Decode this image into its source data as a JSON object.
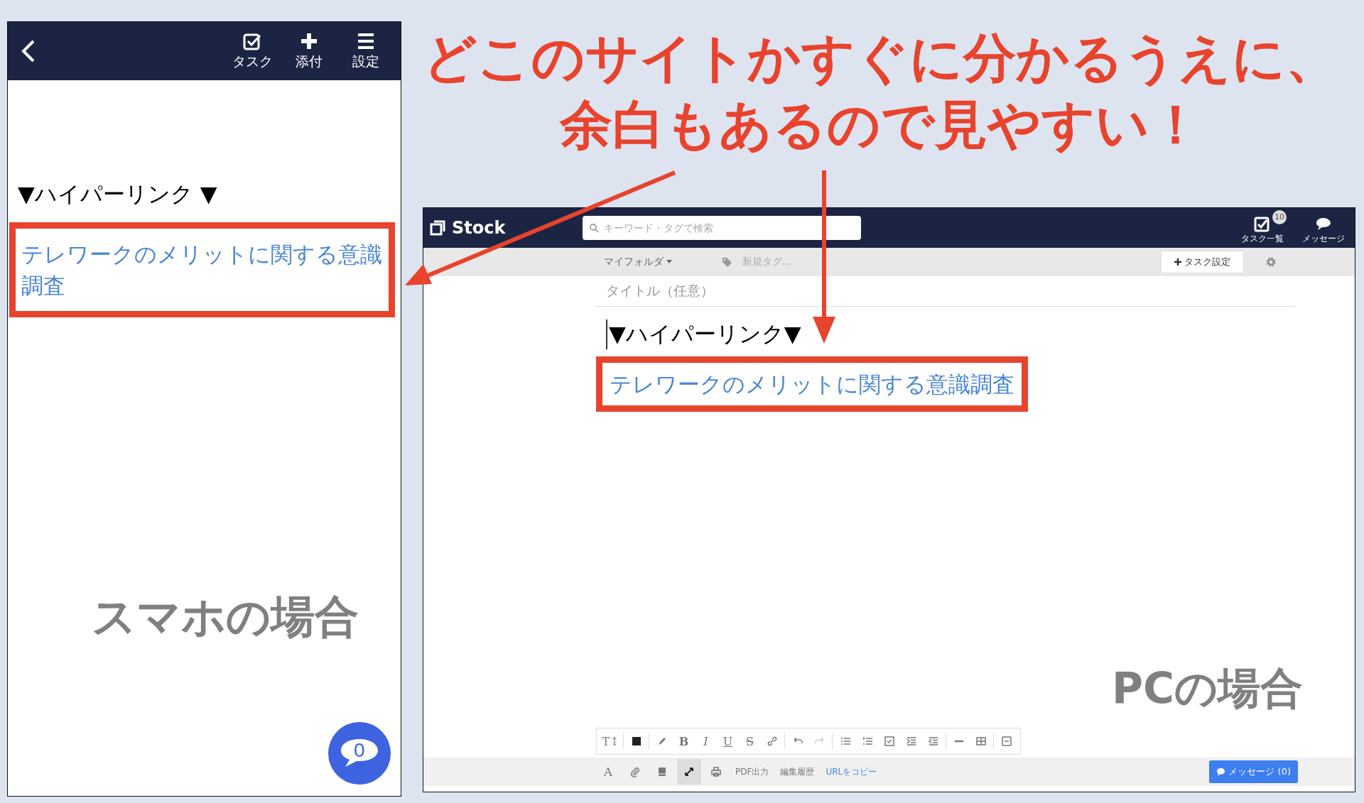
{
  "headline": [
    "どこのサイトかすぐに分かるうえに、",
    "余白もあるので見やすい！"
  ],
  "phone": {
    "toolbar": [
      {
        "kind": "task",
        "label": "タスク"
      },
      {
        "kind": "attach",
        "label": "添付"
      },
      {
        "kind": "settings",
        "label": "設定"
      }
    ],
    "heading": "▼ハイパーリンク ▼",
    "link": "テレワークのメリットに関する意識調査",
    "caption": "スマホの場合",
    "chat_count": "0"
  },
  "pc": {
    "brand": "Stock",
    "search": {
      "placeholder": "キーワード・タグで検索"
    },
    "header_actions": [
      {
        "kind": "tasks",
        "label": "タスク一覧",
        "badge": "10"
      },
      {
        "kind": "messages",
        "label": "メッセージ"
      }
    ],
    "folder": "マイフォルダ",
    "tag_placeholder": "新規タグ...",
    "task_setting": "タスク設定",
    "title_placeholder": "タイトル（任意）",
    "heading": "▼ハイパーリンク▼",
    "link": "テレワークのメリットに関する意識調査",
    "caption": "PCの場合",
    "format_tools": [
      {
        "kind": "text-size",
        "label": "T↕"
      },
      {
        "kind": "divider"
      },
      {
        "kind": "color"
      },
      {
        "kind": "divider"
      },
      {
        "kind": "highlight"
      },
      {
        "kind": "bold",
        "label": "B"
      },
      {
        "kind": "italic",
        "label": "I"
      },
      {
        "kind": "underline",
        "label": "U"
      },
      {
        "kind": "strike",
        "label": "S"
      },
      {
        "kind": "link"
      },
      {
        "kind": "divider"
      },
      {
        "kind": "undo"
      },
      {
        "kind": "redo"
      },
      {
        "kind": "divider"
      },
      {
        "kind": "bullets"
      },
      {
        "kind": "numbers"
      },
      {
        "kind": "checklist"
      },
      {
        "kind": "indent"
      },
      {
        "kind": "outdent"
      },
      {
        "kind": "divider"
      },
      {
        "kind": "rule"
      },
      {
        "kind": "table"
      },
      {
        "kind": "divider"
      },
      {
        "kind": "collapse"
      }
    ],
    "bottom_tools": [
      {
        "kind": "font",
        "label": "A",
        "selected": false
      },
      {
        "kind": "attach",
        "selected": false
      },
      {
        "kind": "book",
        "selected": false
      },
      {
        "kind": "expand",
        "selected": true
      },
      {
        "kind": "print",
        "selected": false
      },
      {
        "kind": "text",
        "label": "PDF出力",
        "selected": false
      },
      {
        "kind": "text",
        "label": "編集履歴",
        "selected": false
      },
      {
        "kind": "link",
        "label": "URLをコピー",
        "selected": false
      }
    ],
    "message_button": "メッセージ (0)"
  }
}
